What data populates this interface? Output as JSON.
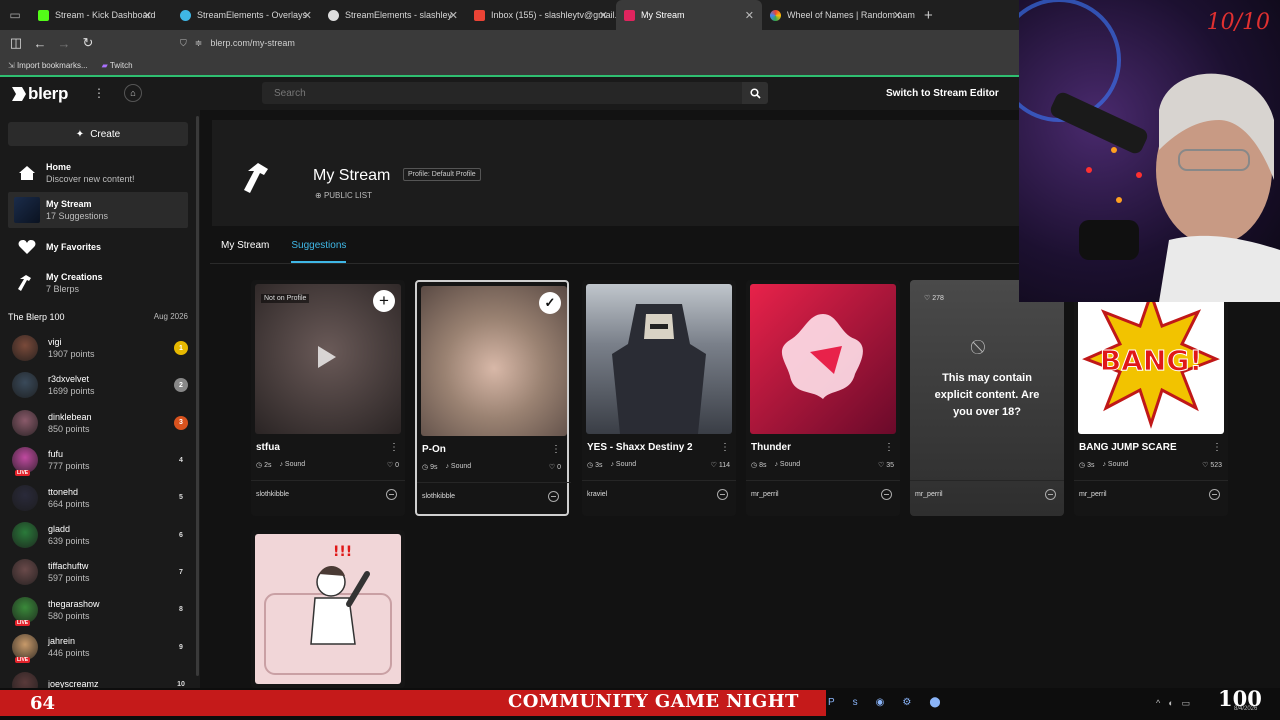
{
  "browser": {
    "tabs": [
      {
        "label": "Stream - Kick Dashboard",
        "color": "#53fc18"
      },
      {
        "label": "StreamElements - Overlays",
        "color": "#3fb7e6"
      },
      {
        "label": "StreamElements - slashley",
        "color": "#dddddd"
      },
      {
        "label": "Inbox (155) - slashleytv@gmail.",
        "color": "#ea4335"
      },
      {
        "label": "My Stream",
        "color": "#e0245e"
      },
      {
        "label": "Wheel of Names | Random nam",
        "color": "#4285f4"
      }
    ],
    "url": "blerp.com/my-stream",
    "bookmarks": [
      "Import bookmarks...",
      "Twitch"
    ]
  },
  "header": {
    "logo": "blerp",
    "search_placeholder": "Search",
    "switch_label": "Switch to Stream Editor"
  },
  "sidebar": {
    "create_label": "Create",
    "nav": [
      {
        "title": "Home",
        "subtitle": "Discover new content!"
      },
      {
        "title": "My Stream",
        "subtitle": "17 Suggestions"
      },
      {
        "title": "My Favorites",
        "subtitle": ""
      },
      {
        "title": "My Creations",
        "subtitle": "7 Blerps"
      }
    ],
    "blerp100_title": "The Blerp 100",
    "blerp100_date": "Aug 2026",
    "leaderboard": [
      {
        "name": "vigi",
        "points": "1907 points",
        "rank": "1",
        "rank_color": "#e6b800",
        "avatar": "#7a4a3a",
        "live": false
      },
      {
        "name": "r3dxvelvet",
        "points": "1699 points",
        "rank": "2",
        "rank_color": "#888888",
        "avatar": "#3a4a5a",
        "live": false
      },
      {
        "name": "dinklebean",
        "points": "850 points",
        "rank": "3",
        "rank_color": "#d9531e",
        "avatar": "#8a5a6a",
        "live": false
      },
      {
        "name": "fufu",
        "points": "777 points",
        "rank": "4",
        "rank_color": "",
        "avatar": "#c04aa0",
        "live": true
      },
      {
        "name": "ttonehd",
        "points": "664 points",
        "rank": "5",
        "rank_color": "",
        "avatar": "#2a2a3a",
        "live": false
      },
      {
        "name": "gladd",
        "points": "639 points",
        "rank": "6",
        "rank_color": "",
        "avatar": "#2a7a3a",
        "live": false
      },
      {
        "name": "tiffachuftw",
        "points": "597 points",
        "rank": "7",
        "rank_color": "",
        "avatar": "#6a4a4a",
        "live": false
      },
      {
        "name": "thegarashow",
        "points": "580 points",
        "rank": "8",
        "rank_color": "",
        "avatar": "#3a8a3a",
        "live": true
      },
      {
        "name": "jahrein",
        "points": "446 points",
        "rank": "9",
        "rank_color": "",
        "avatar": "#c89a6a",
        "live": true
      },
      {
        "name": "joeyscreamz",
        "points": "",
        "rank": "10",
        "rank_color": "",
        "avatar": "#5a3a3a",
        "live": false
      }
    ]
  },
  "main": {
    "title": "My Stream",
    "profile_badge": "Profile: Default Profile",
    "visibility": "PUBLIC LIST",
    "tabs": [
      "My Stream",
      "Suggestions"
    ],
    "cards": [
      {
        "name": "stfua",
        "duration": "2s",
        "type": "Sound",
        "likes": "0",
        "user": "slothkibble",
        "badge": "Not on Profile",
        "thumb": "#3a3434"
      },
      {
        "name": "P-On",
        "duration": "9s",
        "type": "Sound",
        "likes": "0",
        "user": "slothkibble",
        "badge": "",
        "thumb": "#8a7468"
      },
      {
        "name": "YES - Shaxx Destiny 2",
        "duration": "3s",
        "type": "Sound",
        "likes": "114",
        "user": "kraviel",
        "badge": "",
        "thumb": "#5a6272"
      },
      {
        "name": "Thunder",
        "duration": "8s",
        "type": "Sound",
        "likes": "35",
        "user": "mr_perril",
        "badge": "",
        "thumb": "#b01848"
      },
      {
        "name": "",
        "duration": "",
        "type": "",
        "likes": "",
        "user": "mr_perril",
        "badge": "",
        "thumb": "#4a4a4a",
        "explicit_text": "This may contain explicit content. Are you over 18?",
        "explicit_likes": "278"
      },
      {
        "name": "BANG JUMP SCARE",
        "duration": "3s",
        "type": "Sound",
        "likes": "523",
        "user": "mr_perril",
        "badge": "",
        "thumb": "#ffffff"
      },
      {
        "name": "",
        "duration": "",
        "type": "",
        "likes": "",
        "user": "",
        "badge": "",
        "thumb": "#f1d6d8"
      }
    ]
  },
  "overlay": {
    "score": "10/10",
    "left_number": "64",
    "banner": "COMMUNITY GAME NIGHT",
    "right_number": "100",
    "clock": "8/4/2026"
  }
}
